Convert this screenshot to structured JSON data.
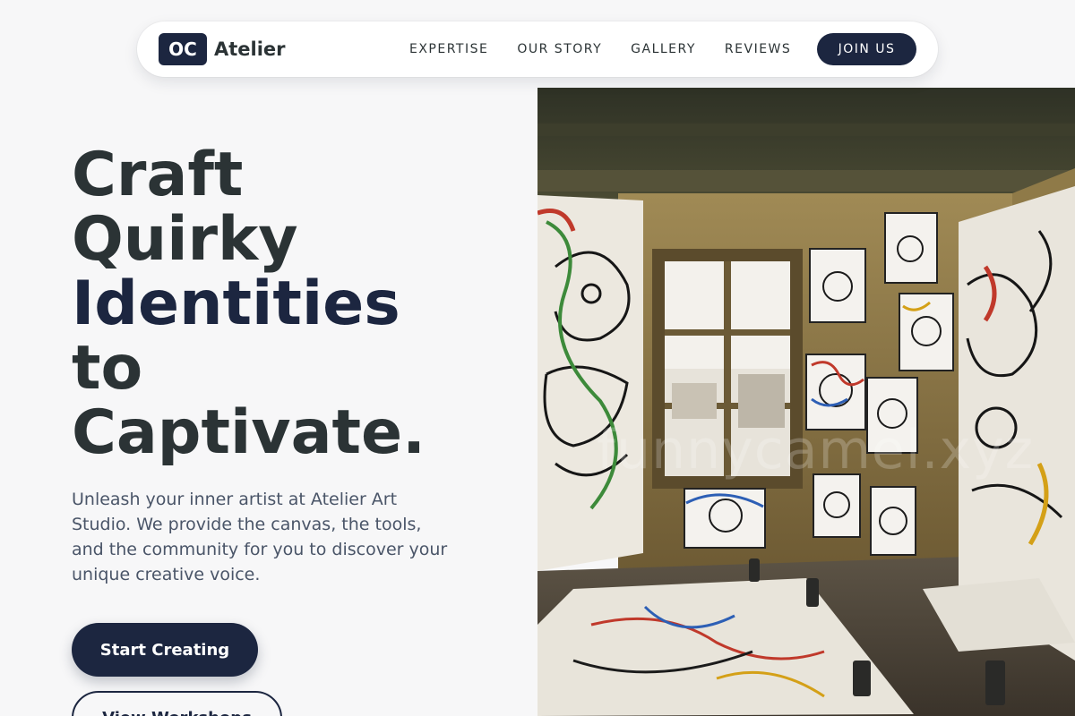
{
  "nav": {
    "logo_badge": "OC",
    "logo_name": "Atelier",
    "links": [
      "EXPERTISE",
      "OUR STORY",
      "GALLERY",
      "REVIEWS"
    ],
    "cta": "JOIN US"
  },
  "hero": {
    "title_lines": [
      "Craft",
      "Quirky",
      "Identities",
      "to",
      "Captivate."
    ],
    "description": "Unleash your inner artist at Atelier Art Studio. We provide the canvas, the tools, and the community for you to discover your unique creative voice.",
    "primary_button": "Start Creating",
    "secondary_button": "View Workshops",
    "image_watermark": "funnycamel.xyz"
  },
  "colors": {
    "brand_dark": "#1c2640",
    "heading": "#2b3335",
    "body_text": "#4a5568",
    "background": "#f7f7f8"
  }
}
